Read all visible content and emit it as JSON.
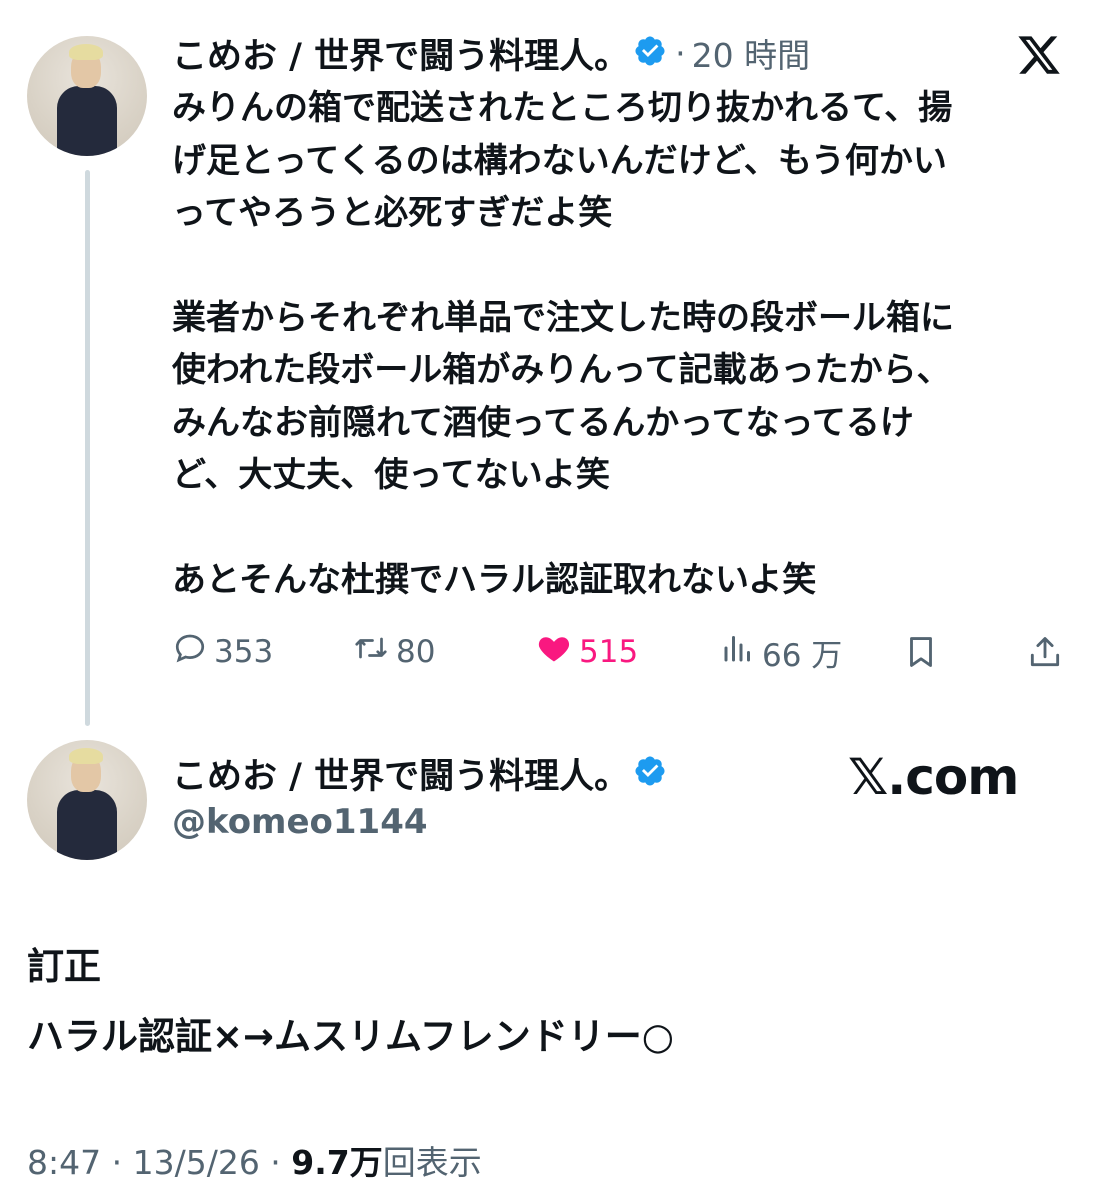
{
  "tweet1": {
    "display_name": "こめお / 世界で闘う料理人。",
    "separator": "·",
    "time": "20 時間",
    "paragraphs": [
      [
        "みりんの箱で配送されたところ切り抜かれるて、揚",
        "げ足とってくるのは構わないんだけど、もう何かい",
        "ってやろうと必死すぎだよ笑"
      ],
      [
        "業者からそれぞれ単品で注文した時の段ボール箱に",
        "使われた段ボール箱がみりんって記載あったから、",
        "みんなお前隠れて酒使ってるんかってなってるけ",
        "ど、大丈夫、使ってないよ笑"
      ],
      [
        "あとそんな杜撰でハラル認証取れないよ笑"
      ]
    ],
    "actions": {
      "replies": "353",
      "retweets": "80",
      "likes": "515",
      "views": "66 万"
    },
    "colors": {
      "like": "#f91880",
      "verified": "#1d9bf0",
      "muted": "#536471"
    }
  },
  "tweet2": {
    "display_name": "こめお / 世界で闘う料理人。",
    "handle": "@komeo1144",
    "watermark_x": "𝕏",
    "watermark_domain": ".com",
    "lines": [
      "訂正",
      "ハラル認証×→ムスリムフレンドリー○"
    ],
    "footer": {
      "time": "8:47",
      "sep1": " · ",
      "date": "13/5/26",
      "sep2": " · ",
      "views_count": "9.7万",
      "views_label": "回表示"
    }
  },
  "icons": [
    "x-logo-icon",
    "verified-badge-icon",
    "reply-icon",
    "retweet-icon",
    "like-icon",
    "views-icon",
    "bookmark-icon",
    "share-icon"
  ]
}
